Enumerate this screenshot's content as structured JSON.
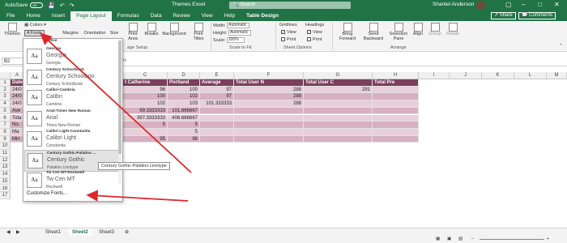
{
  "titlebar": {
    "autosave_label": "AutoSave",
    "autosave_state": "Off",
    "doc_title": "Themes Excel",
    "search_placeholder": "Search",
    "user_name": "Shantel Anderson"
  },
  "tabs": [
    "File",
    "Home",
    "Insert",
    "Page Layout",
    "Formulas",
    "Data",
    "Review",
    "View",
    "Help",
    "Table Design"
  ],
  "active_tab": "Page Layout",
  "share_label": "Share",
  "comments_label": "Comments",
  "ribbon": {
    "themes_label": "Themes",
    "colors_label": "Colors",
    "fonts_label": "Fonts",
    "margins_label": "Margins",
    "orientation_label": "Orientation",
    "size_label": "Size",
    "print_area_label": "Print Area",
    "breaks_label": "Breaks",
    "background_label": "Background",
    "print_titles_label": "Print Titles",
    "page_setup_label": "age Setup",
    "width_label": "Width:",
    "height_label": "Height:",
    "scale_label": "Scale:",
    "width_value": "Automatic",
    "height_value": "Automatic",
    "scale_value": "100%",
    "scale_to_fit_label": "Scale to Fit",
    "gridlines_label": "Gridlines",
    "headings_label": "Headings",
    "view_label": "View",
    "print_label": "Print",
    "sheet_options_label": "Sheet Options",
    "bring_forward_label": "Bring Forward",
    "send_backward_label": "Send Backward",
    "selection_pane_label": "Selection Pane",
    "align_label": "Align",
    "group_label": "Group",
    "rotate_label": "Rotate",
    "arrange_label": "Arrange"
  },
  "name_box": "B2",
  "columns": [
    "C",
    "D",
    "E",
    "F",
    "G",
    "H",
    "I",
    "J",
    "K",
    "L",
    "M",
    "N"
  ],
  "rows": [
    "1",
    "2",
    "3",
    "4",
    "5",
    "6",
    "7",
    "8",
    "9",
    "10",
    "11",
    "12",
    "13",
    "14",
    "15",
    "16",
    "17"
  ],
  "col_a_labels": [
    "Date",
    "24/0",
    "24/0",
    "24/0",
    "Ave",
    "Tota",
    "No.",
    "Ma",
    "Min"
  ],
  "table": {
    "headers": [
      "t Catherine",
      "Portland",
      "Average",
      "Total User N",
      "Total User C",
      "Total Pre"
    ],
    "rows": [
      [
        "96",
        "100",
        "97",
        "288",
        "291",
        ""
      ],
      [
        "100",
        "102",
        "97",
        "288",
        "",
        ""
      ],
      [
        "102",
        "103",
        "101.333333",
        "288",
        "",
        ""
      ],
      [
        "99.3333333",
        "101.666667",
        "",
        "",
        "",
        ""
      ],
      [
        "397.3333333",
        "406.666667",
        "",
        "",
        "",
        ""
      ],
      [
        "5",
        "5",
        "",
        "",
        "",
        ""
      ],
      [
        "",
        "5",
        "",
        "",
        "",
        ""
      ],
      [
        "95",
        "96",
        "",
        "",
        "",
        ""
      ]
    ]
  },
  "font_menu": {
    "top_partial": "Office",
    "items": [
      {
        "name": "Georgia",
        "heading": "Georgia",
        "body": "Georgia"
      },
      {
        "name": "Century Schoolbook",
        "heading": "Century Schoolboo",
        "body": "Century Schoolbook"
      },
      {
        "name": "Calibri-Cambria",
        "heading": "Calibri",
        "body": "Cambria"
      },
      {
        "name": "Arial-Times New Roman",
        "heading": "Arial",
        "body": "Times New Roman"
      },
      {
        "name": "Calibri Light-Constantia",
        "heading": "Calibri Light",
        "body": "Constantia"
      },
      {
        "name": "Century Gothic-Palatino ...",
        "heading": "Century Gothic",
        "body": "Palatino Linotype"
      },
      {
        "name": "Tw Cen MT-Rockwell",
        "heading": "Tw Cen MT",
        "body": "Rockwell"
      }
    ],
    "customize_label": "Customize Fonts...",
    "preview_glyph": "Aa"
  },
  "tooltip_text": "Century Gothic-Palatino Linotype",
  "sheets": [
    "Sheet1",
    "Sheet2",
    "Sheet3"
  ],
  "active_sheet": "Sheet2",
  "colors": {
    "excel_green": "#217346",
    "table_header": "#7b3f5c",
    "band_light": "#e8cfda",
    "band_dark": "#d7b0c1",
    "arrow": "#e0262a"
  }
}
